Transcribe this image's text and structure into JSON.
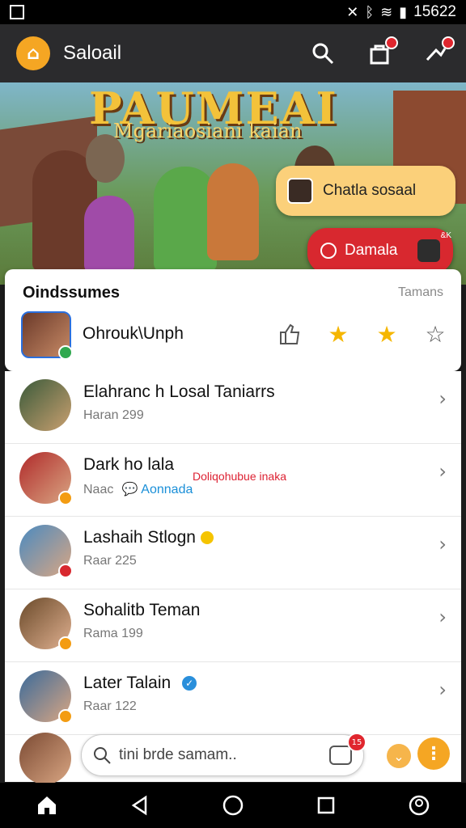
{
  "status_bar": {
    "time": "15622",
    "icons": [
      "mute-icon",
      "bluetooth-icon",
      "wifi-icon",
      "signal-icon",
      "battery-icon"
    ]
  },
  "app_bar": {
    "title": "Saloail",
    "logo_icon": "app-logo-icon",
    "actions": [
      "search-icon",
      "shopping-bag-icon",
      "network-icon"
    ]
  },
  "banner": {
    "title": "PAUMEAI",
    "subtitle": "Mgariaosiani kaian"
  },
  "chips": {
    "chat": "Chatla sosaal",
    "demo": "Damala",
    "demo_badge": "&K"
  },
  "card": {
    "title": "Oindssumes",
    "right_label": "Tamans",
    "name": "Ohrouk\\Unph"
  },
  "list": {
    "items": [
      {
        "title": "Elahranc h Losal Taniarrs",
        "subtitle": "Haran 299"
      },
      {
        "title": "Dark ho lala",
        "subtitle": "Naac",
        "subtitle_link": "Aonnada",
        "inline_red": "Doliqohubue inaka"
      },
      {
        "title": "Lashaih Stlogn",
        "subtitle": "Raar 225"
      },
      {
        "title": "Sohalitb Teman",
        "subtitle": "Rama 199"
      },
      {
        "title": "Later Talain",
        "subtitle": "Raar 122"
      }
    ]
  },
  "search": {
    "placeholder": "tini brde samam..",
    "badge": "15"
  },
  "colors": {
    "accent": "#f5a623",
    "danger": "#d8282f",
    "chip_yellow": "#fbd07a"
  }
}
